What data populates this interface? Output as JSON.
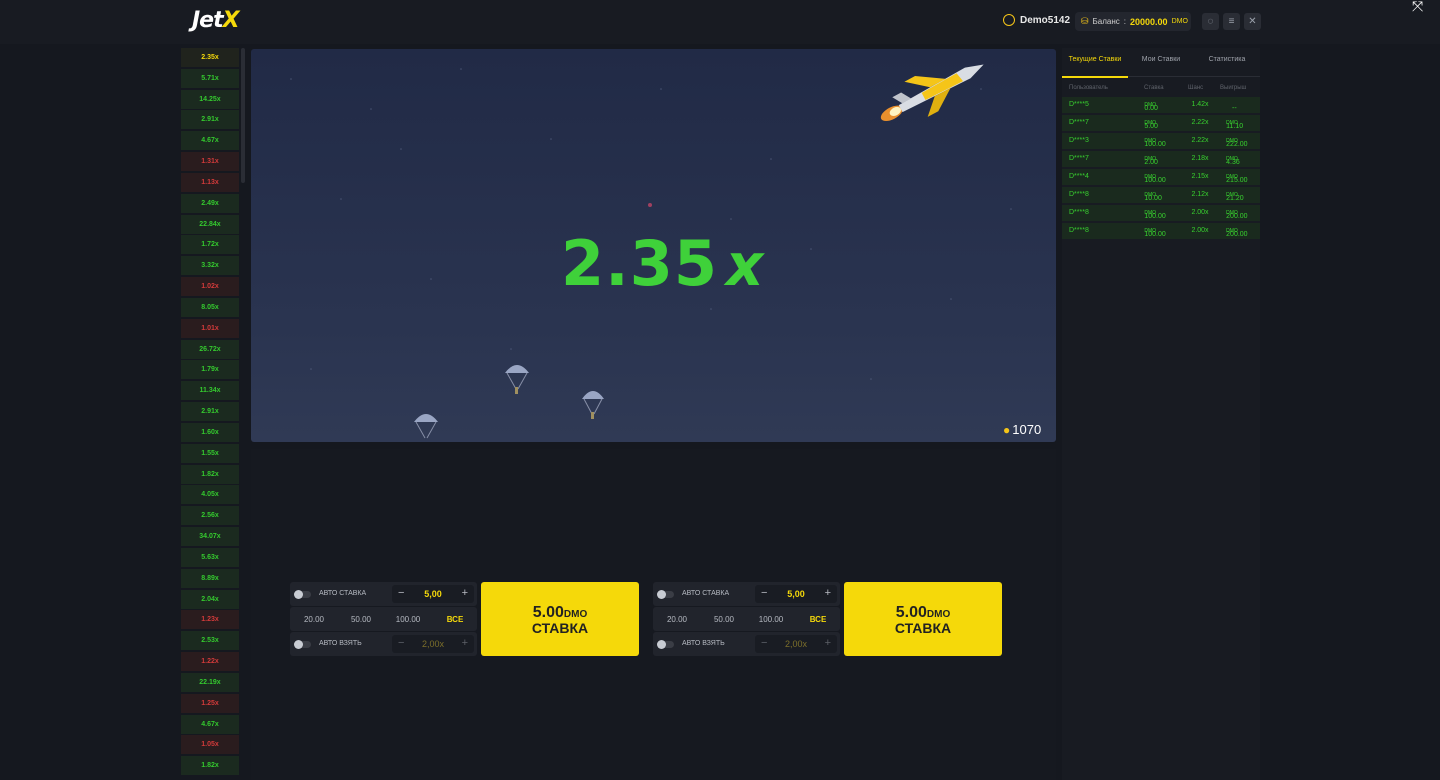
{
  "header": {
    "logo_main": "Jet",
    "logo_accent": "X",
    "username": "Demo5142",
    "balance_label": "Баланс",
    "balance_amount": "20000.00",
    "balance_currency": "DMO",
    "chat_icon": "chat-icon",
    "menu_icon": "menu-icon",
    "close_icon": "close-icon"
  },
  "history": [
    {
      "v": "2.35x",
      "c": "first"
    },
    {
      "v": "5.71x",
      "c": "green"
    },
    {
      "v": "14.25x",
      "c": "green"
    },
    {
      "v": "2.91x",
      "c": "green"
    },
    {
      "v": "4.67x",
      "c": "green"
    },
    {
      "v": "1.31x",
      "c": "red"
    },
    {
      "v": "1.13x",
      "c": "red"
    },
    {
      "v": "2.49x",
      "c": "green"
    },
    {
      "v": "22.84x",
      "c": "green"
    },
    {
      "v": "1.72x",
      "c": "green"
    },
    {
      "v": "3.32x",
      "c": "green"
    },
    {
      "v": "1.02x",
      "c": "red"
    },
    {
      "v": "8.05x",
      "c": "green"
    },
    {
      "v": "1.01x",
      "c": "red"
    },
    {
      "v": "26.72x",
      "c": "green"
    },
    {
      "v": "1.79x",
      "c": "green"
    },
    {
      "v": "11.34x",
      "c": "green"
    },
    {
      "v": "2.91x",
      "c": "green"
    },
    {
      "v": "1.60x",
      "c": "green"
    },
    {
      "v": "1.55x",
      "c": "green"
    },
    {
      "v": "1.82x",
      "c": "green"
    },
    {
      "v": "4.05x",
      "c": "green"
    },
    {
      "v": "2.56x",
      "c": "green"
    },
    {
      "v": "34.07x",
      "c": "green"
    },
    {
      "v": "5.63x",
      "c": "green"
    },
    {
      "v": "8.89x",
      "c": "green"
    },
    {
      "v": "2.04x",
      "c": "green"
    },
    {
      "v": "1.23x",
      "c": "red"
    },
    {
      "v": "2.53x",
      "c": "green"
    },
    {
      "v": "1.22x",
      "c": "red"
    },
    {
      "v": "22.19x",
      "c": "green"
    },
    {
      "v": "1.25x",
      "c": "red"
    },
    {
      "v": "4.67x",
      "c": "green"
    },
    {
      "v": "1.05x",
      "c": "red"
    },
    {
      "v": "1.82x",
      "c": "green"
    }
  ],
  "game": {
    "multiplier": "2.35",
    "multiplier_suffix": "x",
    "players_count": "1070"
  },
  "bet_panels": [
    {
      "auto_bet_label": "АВТО СТАВКА",
      "bet_value": "5,00",
      "quick": [
        "20.00",
        "50.00",
        "100.00",
        "ВСЕ"
      ],
      "auto_cashout_label": "АВТО ВЗЯТЬ",
      "cashout_value": "2,00x",
      "button_amount": "5.00",
      "button_currency": "DMO",
      "button_label": "СТАВКА"
    },
    {
      "auto_bet_label": "АВТО СТАВКА",
      "bet_value": "5,00",
      "quick": [
        "20.00",
        "50.00",
        "100.00",
        "ВСЕ"
      ],
      "auto_cashout_label": "АВТО ВЗЯТЬ",
      "cashout_value": "2,00x",
      "button_amount": "5.00",
      "button_currency": "DMO",
      "button_label": "СТАВКА"
    }
  ],
  "bets_panel": {
    "tabs": [
      "Текущие Ставки",
      "Мои Ставки",
      "Статистика"
    ],
    "columns": [
      "Пользователь",
      "Ставка",
      "Шанс",
      "Выигрыш"
    ],
    "rows": [
      {
        "user": "D****5",
        "bet": "0.00",
        "cur": "DMO",
        "coef": "1.42x",
        "win": "--",
        "wcur": ""
      },
      {
        "user": "D****7",
        "bet": "5.00",
        "cur": "DMO",
        "coef": "2.22x",
        "win": "11.10",
        "wcur": "DMO"
      },
      {
        "user": "D****3",
        "bet": "100.00",
        "cur": "DMO",
        "coef": "2.22x",
        "win": "222.00",
        "wcur": "DMO"
      },
      {
        "user": "D****7",
        "bet": "2.00",
        "cur": "DMO",
        "coef": "2.18x",
        "win": "4.36",
        "wcur": "DMO"
      },
      {
        "user": "D****4",
        "bet": "100.00",
        "cur": "DMO",
        "coef": "2.15x",
        "win": "215.00",
        "wcur": "DMO"
      },
      {
        "user": "D****8",
        "bet": "10.00",
        "cur": "DMO",
        "coef": "2.12x",
        "win": "21.20",
        "wcur": "DMO"
      },
      {
        "user": "D****8",
        "bet": "100.00",
        "cur": "DMO",
        "coef": "2.00x",
        "win": "200.00",
        "wcur": "DMO"
      },
      {
        "user": "D****8",
        "bet": "100.00",
        "cur": "DMO",
        "coef": "2.00x",
        "win": "200.00",
        "wcur": "DMO"
      }
    ]
  },
  "colors": {
    "accent": "#f5d90a",
    "win_green": "#3fd13a",
    "loss_red": "#d23a3a",
    "sky": "#2a3450"
  }
}
